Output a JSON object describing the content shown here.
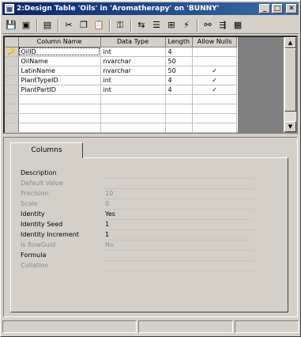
{
  "window": {
    "title": "2:Design Table 'Oils' in 'Aromatherapy' on 'BUNNY'",
    "controls": [
      "_",
      "□",
      "✕"
    ]
  },
  "toolbar": {
    "buttons": [
      {
        "icon": "save-icon",
        "glyph": "💾"
      },
      {
        "icon": "properties-icon",
        "glyph": "▣"
      },
      {
        "icon": "generate-script-icon",
        "glyph": "▤"
      },
      {
        "icon": "cut-icon",
        "glyph": "✂"
      },
      {
        "icon": "copy-icon",
        "glyph": "❐"
      },
      {
        "icon": "paste-icon",
        "glyph": "📋"
      },
      {
        "icon": "primary-key-icon",
        "glyph": "⚿"
      },
      {
        "icon": "manage-relationships-icon",
        "glyph": "⇆"
      },
      {
        "icon": "manage-indexes-icon",
        "glyph": "☰"
      },
      {
        "icon": "manage-constraints-icon",
        "glyph": "⊞"
      },
      {
        "icon": "manage-triggers-icon",
        "glyph": "⚡"
      },
      {
        "icon": "diagram-icon",
        "glyph": "⚯"
      },
      {
        "icon": "script-table-icon",
        "glyph": "⇶"
      },
      {
        "icon": "layout-icon",
        "glyph": "▦"
      }
    ]
  },
  "grid": {
    "headers": [
      "Column Name",
      "Data Type",
      "Length",
      "Allow Nulls"
    ],
    "rows": [
      {
        "name": "OilID",
        "type": "int",
        "length": "4",
        "nulls": "",
        "pk": "🔑"
      },
      {
        "name": "OilName",
        "type": "nvarchar",
        "length": "50",
        "nulls": ""
      },
      {
        "name": "LatinName",
        "type": "nvarchar",
        "length": "50",
        "nulls": "✓"
      },
      {
        "name": "PlantTypeID",
        "type": "int",
        "length": "4",
        "nulls": "✓"
      },
      {
        "name": "PlantPartID",
        "type": "int",
        "length": "4",
        "nulls": "✓"
      }
    ]
  },
  "properties": {
    "tab_label": "Columns",
    "items": [
      {
        "label": "Description",
        "value": "",
        "disabled": false
      },
      {
        "label": "Default Value",
        "value": "",
        "disabled": true
      },
      {
        "label": "Precision",
        "value": "10",
        "disabled": true
      },
      {
        "label": "Scale",
        "value": "0",
        "disabled": true
      },
      {
        "label": "Identity",
        "value": "Yes",
        "disabled": false
      },
      {
        "label": "Identity Seed",
        "value": "1",
        "disabled": false
      },
      {
        "label": "Identity Increment",
        "value": "1",
        "disabled": false
      },
      {
        "label": "Is RowGuid",
        "value": "No",
        "disabled": true
      },
      {
        "label": "Formula",
        "value": "",
        "disabled": false
      },
      {
        "label": "Collation",
        "value": "",
        "disabled": true
      }
    ]
  }
}
